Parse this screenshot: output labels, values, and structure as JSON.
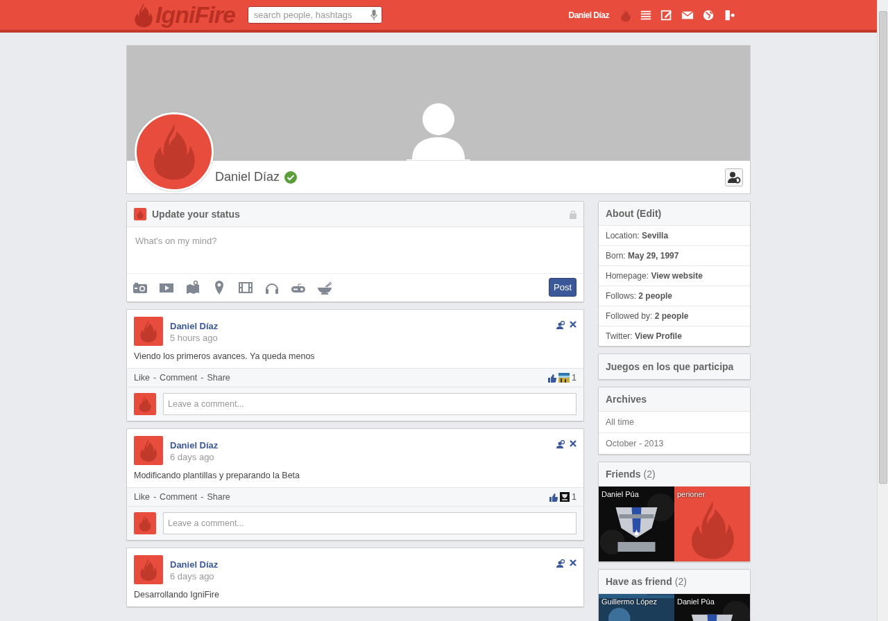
{
  "topbar": {
    "logo": "IgniFire",
    "search": {
      "placeholder": "search people, hashtags"
    },
    "user": "Daniel Díaz"
  },
  "profile": {
    "name": "Daniel Díaz",
    "verified": true
  },
  "status": {
    "title": "Update your status",
    "placeholder": "What's on my mind?",
    "post": "Post"
  },
  "posts": [
    {
      "author": "Daniel Díaz",
      "time": "5 hours ago",
      "text": "Viendo los primeros avances. Ya queda menos",
      "actions": [
        "Like",
        "Comment",
        "Share"
      ],
      "separator": "-",
      "likes": "1",
      "comment_placeholder": "Leave a comment..."
    },
    {
      "author": "Daniel Díaz",
      "time": "6 days ago",
      "text": "Modificando plantillas y preparando la Beta",
      "actions": [
        "Like",
        "Comment",
        "Share"
      ],
      "separator": "-",
      "likes": "1",
      "liker": {
        "kind": "logo"
      },
      "comment_placeholder": "Leave a comment..."
    },
    {
      "author": "Daniel Díaz",
      "time": "6 days ago",
      "text": "Desarrollando IgniFire"
    }
  ],
  "about": {
    "title": "About",
    "edit": "(Edit)",
    "rows": [
      {
        "label": "Location:",
        "value": "Sevilla"
      },
      {
        "label": "Born:",
        "value": "May 29, 1997"
      },
      {
        "label": "Homepage:",
        "value": "View website"
      },
      {
        "label": "Follows:",
        "value": "2 people"
      },
      {
        "label": "Followed by:",
        "value": "2 people"
      },
      {
        "label": "Twitter:",
        "value": "View Profile"
      }
    ]
  },
  "games": {
    "title": "Juegos en los que participa"
  },
  "archives": {
    "title": "Archives",
    "items": [
      "All time",
      "October - 2013"
    ]
  },
  "friends": {
    "title": "Friends",
    "count": "(2)",
    "tiles": [
      {
        "name": "Daniel Púa",
        "kind": "picture"
      },
      {
        "name": "perioner",
        "kind": "flame"
      }
    ]
  },
  "have_as_friend": {
    "title": "Have as friend",
    "count": "(2)",
    "tiles": [
      {
        "name": "Guillermo López",
        "kind": "banner"
      },
      {
        "name": "Daniel Púa",
        "kind": "picture"
      }
    ]
  }
}
